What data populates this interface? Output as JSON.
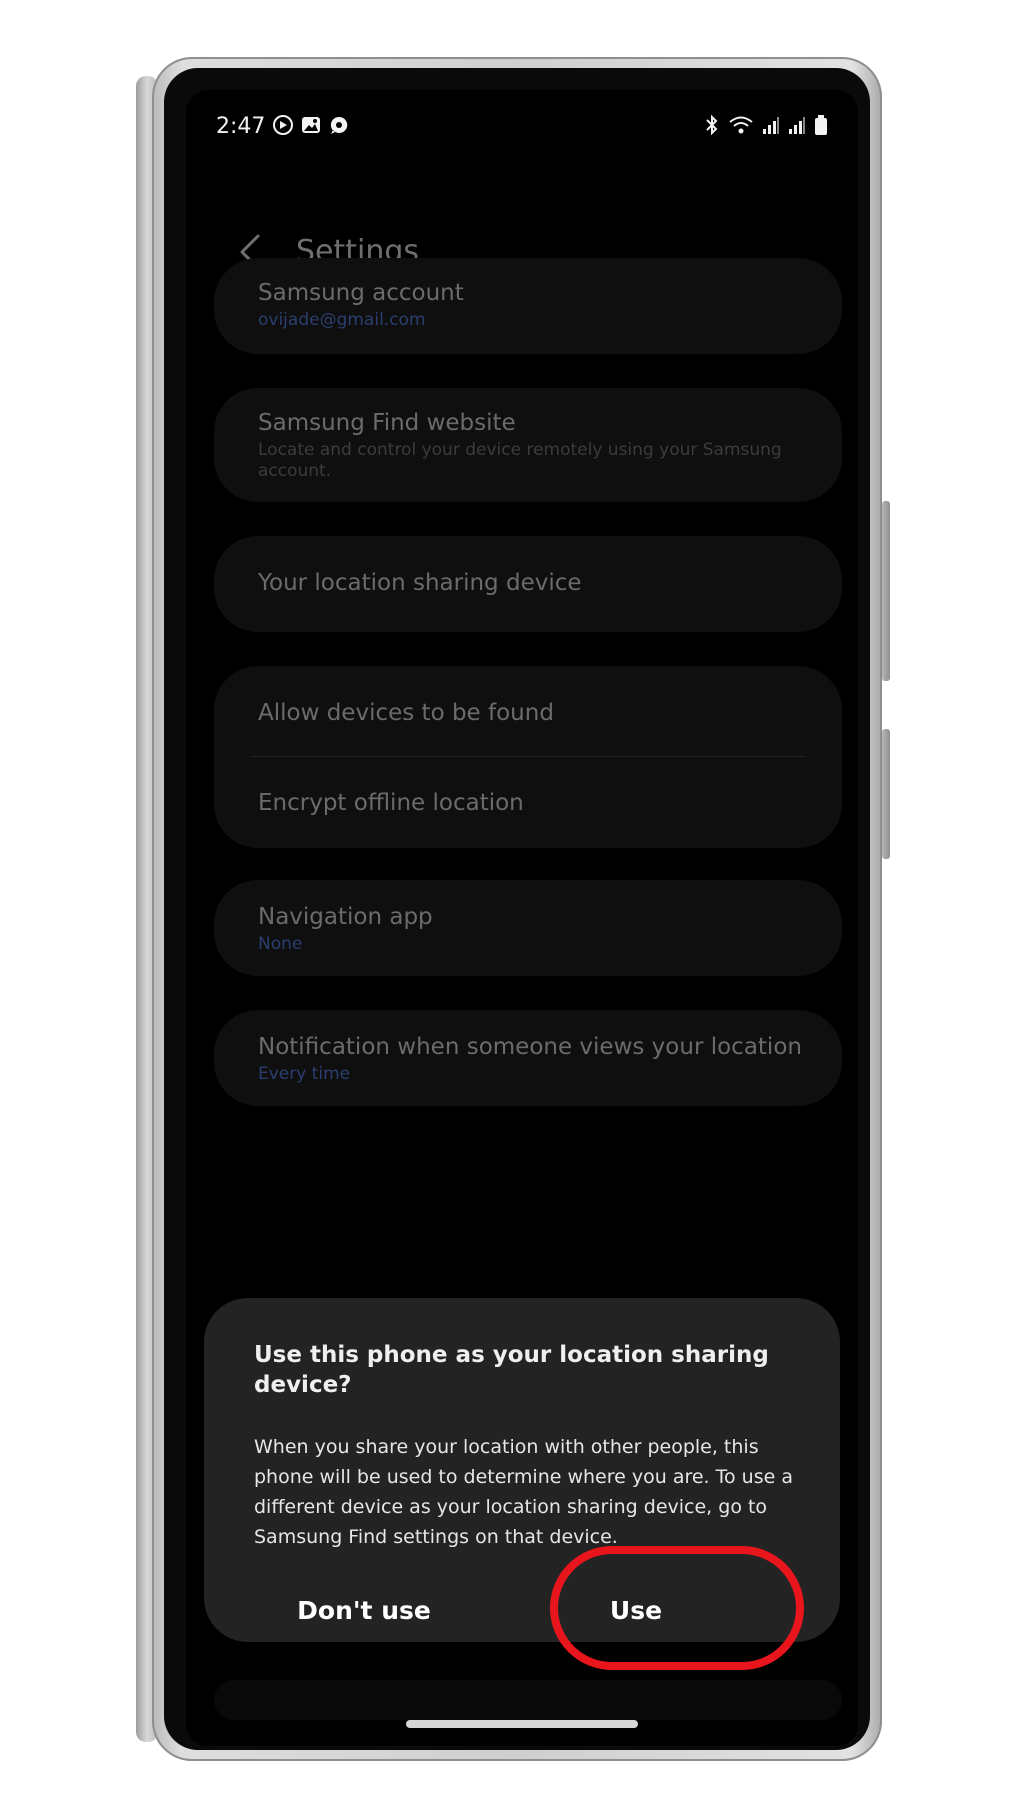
{
  "status_bar": {
    "time": "2:47",
    "left_icons": [
      "whatsapp-status-icon",
      "gallery-icon",
      "chat-bubble-icon"
    ],
    "right_icons": [
      "bluetooth-icon",
      "wifi-icon",
      "signal-icon",
      "signal-icon-2",
      "battery-icon"
    ]
  },
  "header": {
    "title": "Settings",
    "back_icon": "chevron-left-icon"
  },
  "settings": {
    "samsung_account": {
      "title": "Samsung account",
      "value": "ovijade@gmail.com"
    },
    "find_website": {
      "title": "Samsung Find website",
      "description": "Locate and control your device remotely using your Samsung account."
    },
    "location_sharing_device": {
      "title": "Your location sharing device"
    },
    "allow_devices_found": {
      "title": "Allow devices to be found"
    },
    "encrypt_offline": {
      "title": "Encrypt offline location"
    },
    "navigation_app": {
      "title": "Navigation app",
      "value": "None"
    },
    "notification_views": {
      "title": "Notification when someone views your location",
      "value": "Every time"
    }
  },
  "dialog": {
    "title": "Use this phone as your location sharing device?",
    "body": "When you share your location with other people, this phone will be used to determine where you are. To use a different device as your location sharing device, go to Samsung Find settings on that device.",
    "dont_use_label": "Don't use",
    "use_label": "Use"
  },
  "colors": {
    "highlight_ring": "#e8161c",
    "link_blue": "#2a3f6f"
  }
}
